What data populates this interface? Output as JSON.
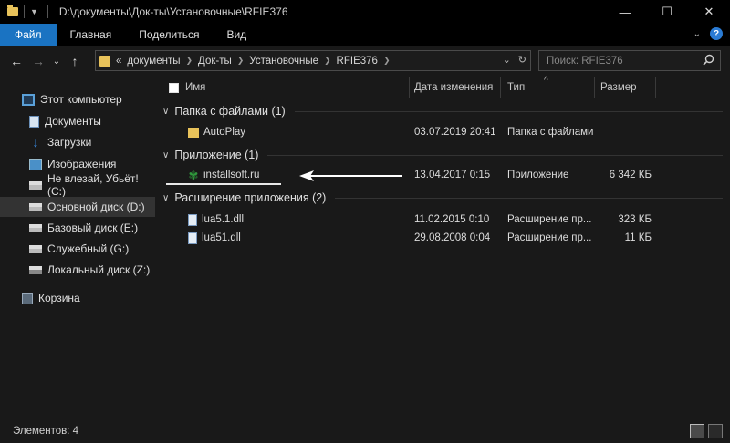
{
  "titlebar": {
    "path": "D:\\документы\\Док-ты\\Установочные\\RFIE376",
    "minimize": "—",
    "maximize": "☐",
    "close": "✕"
  },
  "ribbon": {
    "tabs": [
      "Файл",
      "Главная",
      "Поделиться",
      "Вид"
    ],
    "help": "?"
  },
  "nav": {
    "back": "←",
    "forward": "→",
    "recent": "⌄",
    "up": "↑",
    "crumbs": [
      "«",
      "документы",
      "Док-ты",
      "Установочные",
      "RFIE376"
    ],
    "refresh": "↻",
    "dropdown": "⌄",
    "search_placeholder": "Поиск: RFIE376"
  },
  "sidebar": {
    "items": [
      {
        "label": "Этот компьютер",
        "icon": "computer-icon"
      },
      {
        "label": "Документы",
        "icon": "documents-icon"
      },
      {
        "label": "Загрузки",
        "icon": "downloads-icon"
      },
      {
        "label": "Изображения",
        "icon": "pictures-icon"
      },
      {
        "label": "Не влезай, Убьёт! (C:)",
        "icon": "drive-icon"
      },
      {
        "label": "Основной диск (D:)",
        "icon": "drive-icon",
        "selected": true
      },
      {
        "label": "Базовый диск (E:)",
        "icon": "drive-icon"
      },
      {
        "label": "Служебный (G:)",
        "icon": "drive-icon"
      },
      {
        "label": "Локальный диск (Z:)",
        "icon": "drive-icon"
      },
      {
        "label": "Корзина",
        "icon": "recycle-bin-icon"
      }
    ]
  },
  "columns": {
    "name": "Имя",
    "date": "Дата изменения",
    "type": "Тип",
    "size": "Размер",
    "sort": "^"
  },
  "groups": [
    {
      "label": "Папка с файлами (1)",
      "rows": [
        {
          "name": "AutoPlay",
          "date": "03.07.2019 20:41",
          "type": "Папка с файлами",
          "size": "",
          "icon": "folder-icon"
        }
      ]
    },
    {
      "label": "Приложение (1)",
      "rows": [
        {
          "name": "installsoft.ru",
          "date": "13.04.2017 0:15",
          "type": "Приложение",
          "size": "6 342 КБ",
          "icon": "application-icon"
        }
      ]
    },
    {
      "label": "Расширение приложения (2)",
      "rows": [
        {
          "name": "lua5.1.dll",
          "date": "11.02.2015 0:10",
          "type": "Расширение пр...",
          "size": "323 КБ",
          "icon": "dll-file-icon"
        },
        {
          "name": "lua51.dll",
          "date": "29.08.2008 0:04",
          "type": "Расширение пр...",
          "size": "11 КБ",
          "icon": "dll-file-icon"
        }
      ]
    }
  ],
  "status": {
    "count": "Элементов: 4"
  },
  "colors": {
    "file_tab": "#1a73c2",
    "background": "#191919",
    "folder": "#e8c25a"
  }
}
